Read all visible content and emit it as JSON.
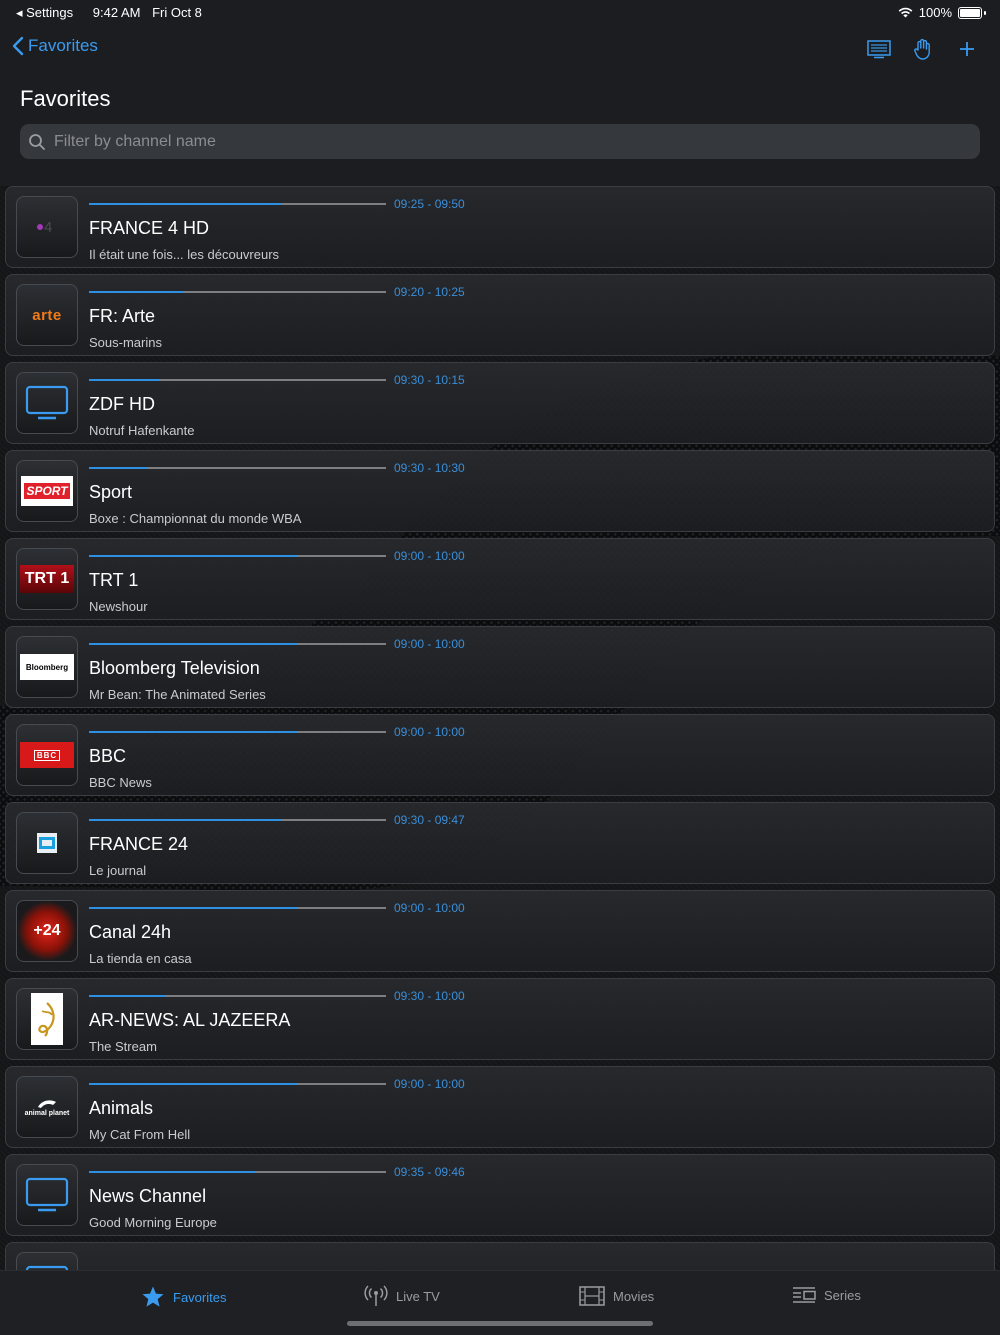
{
  "status_bar": {
    "back_app": "Settings",
    "time": "9:42 AM",
    "date": "Fri Oct 8",
    "battery": "100%"
  },
  "nav": {
    "back_label": "Favorites",
    "title": "Favorites"
  },
  "search": {
    "placeholder": "Filter by channel name"
  },
  "colors": {
    "accent": "#3a9bf0",
    "progress_track": "#7d7f83"
  },
  "channels": [
    {
      "name": "FRANCE 4 HD",
      "program": "Il était une fois... les découvreurs",
      "time": "09:25 - 09:50",
      "progress": 0.65,
      "logo": "france4-logo"
    },
    {
      "name": "FR: Arte",
      "program": "Sous-marins",
      "time": "09:20 - 10:25",
      "progress": 0.32,
      "logo": "arte-logo",
      "logo_text": "arte"
    },
    {
      "name": "ZDF HD",
      "program": "Notruf Hafenkante",
      "time": "09:30 - 10:15",
      "progress": 0.24,
      "logo": "tv-icon"
    },
    {
      "name": "Sport",
      "program": "Boxe : Championnat du monde WBA",
      "time": "09:30 - 10:30",
      "progress": 0.2,
      "logo": "sport-logo",
      "logo_text": "SPORT"
    },
    {
      "name": "TRT 1",
      "program": "Newshour",
      "time": "09:00 - 10:00",
      "progress": 0.7,
      "logo": "trt1-logo",
      "logo_text": "TRT 1"
    },
    {
      "name": "Bloomberg Television",
      "program": "Mr Bean: The Animated Series",
      "time": "09:00 - 10:00",
      "progress": 0.7,
      "logo": "bloomberg-logo",
      "logo_text": "Bloomberg"
    },
    {
      "name": "BBC",
      "program": "BBC News",
      "time": "09:00 - 10:00",
      "progress": 0.7,
      "logo": "bbc-logo",
      "logo_text": "BBC"
    },
    {
      "name": "FRANCE 24",
      "program": "Le journal",
      "time": "09:30 - 09:47",
      "progress": 0.65,
      "logo": "france24-logo"
    },
    {
      "name": "Canal 24h",
      "program": "La tienda en casa",
      "time": "09:00 - 10:00",
      "progress": 0.7,
      "logo": "canal24h-logo",
      "logo_text": "+24"
    },
    {
      "name": "AR-NEWS: AL JAZEERA",
      "program": "The Stream",
      "time": "09:30 - 10:00",
      "progress": 0.26,
      "logo": "aljazeera-logo"
    },
    {
      "name": "Animals",
      "program": "My Cat From Hell",
      "time": "09:00 - 10:00",
      "progress": 0.7,
      "logo": "animal-planet-logo",
      "logo_text": "animal planet"
    },
    {
      "name": "News Channel",
      "program": "Good Morning Europe",
      "time": "09:35 - 09:46",
      "progress": 0.56,
      "logo": "tv-icon"
    }
  ],
  "tabs": [
    {
      "label": "Favorites",
      "icon": "star-icon",
      "active": true
    },
    {
      "label": "Live TV",
      "icon": "antenna-icon",
      "active": false
    },
    {
      "label": "Movies",
      "icon": "film-icon",
      "active": false
    },
    {
      "label": "Series",
      "icon": "series-icon",
      "active": false
    }
  ]
}
